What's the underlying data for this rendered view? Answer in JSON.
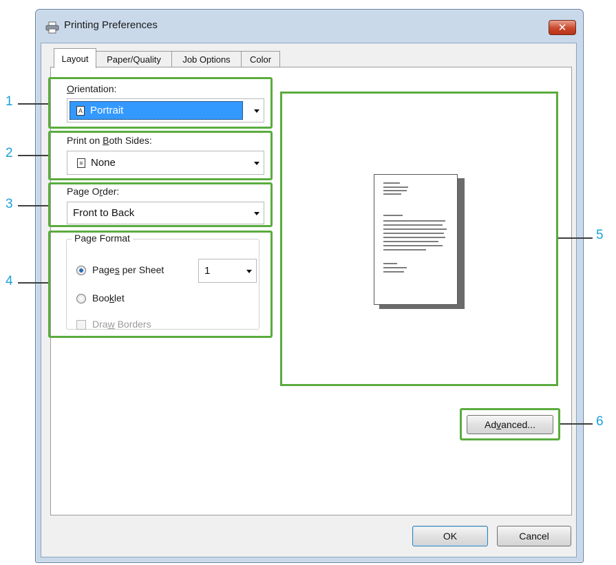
{
  "window": {
    "title": "Printing Preferences",
    "close_glyph": "✕"
  },
  "tabs": [
    {
      "label": "Layout",
      "active": true
    },
    {
      "label": "Paper/Quality",
      "active": false
    },
    {
      "label": "Job Options",
      "active": false
    },
    {
      "label": "Color",
      "active": false
    }
  ],
  "orientation": {
    "label_prefix": "",
    "label_underlined": "O",
    "label_rest": "rientation:",
    "value": "Portrait",
    "icon": "A"
  },
  "duplex": {
    "label_prefix": "Print on ",
    "label_underlined": "B",
    "label_rest": "oth Sides:",
    "value": "None",
    "icon": "≡"
  },
  "page_order": {
    "label_prefix": "Page O",
    "label_underlined": "r",
    "label_rest": "der:",
    "value": "Front to Back"
  },
  "page_format": {
    "legend": "Page Format",
    "pages_per_sheet": {
      "label_prefix": "Page",
      "label_underlined": "s",
      "label_rest": " per Sheet",
      "value": "1",
      "checked": true
    },
    "booklet": {
      "label_prefix": "Boo",
      "label_underlined": "k",
      "label_rest": "let",
      "checked": false
    },
    "draw_borders": {
      "label_prefix": "Dra",
      "label_underlined": "w",
      "label_rest": " Borders",
      "checked": false,
      "disabled": true
    }
  },
  "buttons": {
    "advanced_prefix": "Ad",
    "advanced_underlined": "v",
    "advanced_rest": "anced...",
    "ok": "OK",
    "cancel": "Cancel"
  },
  "callouts": [
    "1",
    "2",
    "3",
    "4",
    "5",
    "6"
  ],
  "colors": {
    "highlight": "#5aab3d",
    "callout": "#1aa0d8",
    "selection": "#3399ff"
  }
}
